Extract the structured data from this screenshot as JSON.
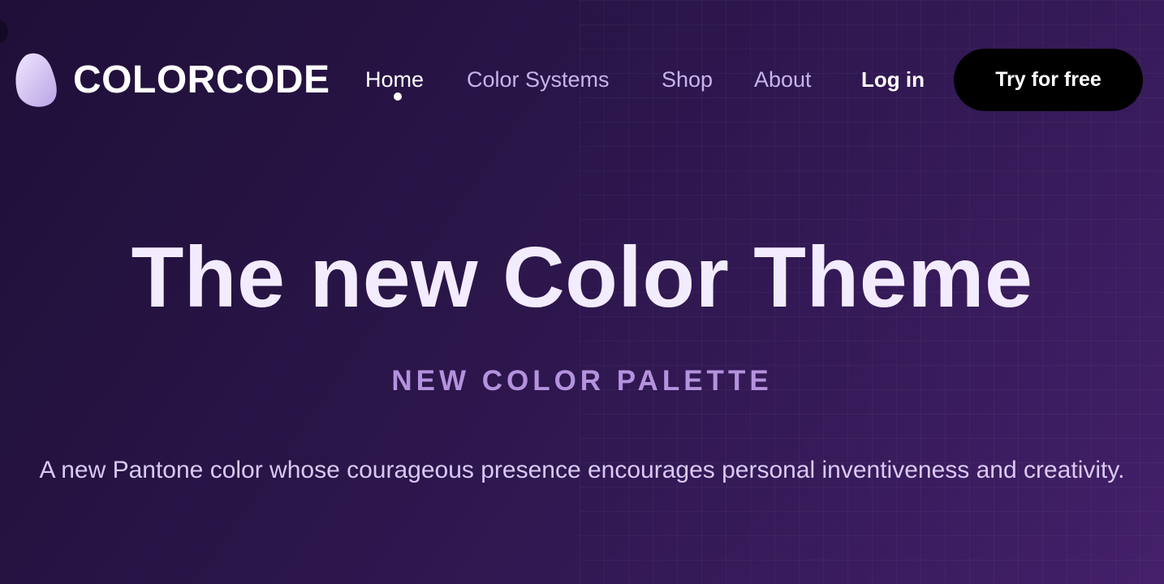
{
  "header": {
    "brand": "COLORCODE",
    "nav": [
      {
        "label": "Home",
        "active": true
      },
      {
        "label": "Color Systems",
        "active": false
      },
      {
        "label": "Shop",
        "active": false
      },
      {
        "label": "About",
        "active": false
      }
    ],
    "login_label": "Log in",
    "cta_label": "Try for free"
  },
  "hero": {
    "title": "The new Color Theme",
    "subtitle": "NEW COLOR PALETTE",
    "description": "A new Pantone color whose courageous presence encourages personal inventiveness and creativity."
  },
  "colors": {
    "background_start": "#1f0f38",
    "background_end": "#44206a",
    "accent": "#b492de",
    "cta_background": "#000000",
    "logo_mark": "#c9b8ec"
  },
  "icons": {
    "logo": "blob-logo-icon"
  }
}
